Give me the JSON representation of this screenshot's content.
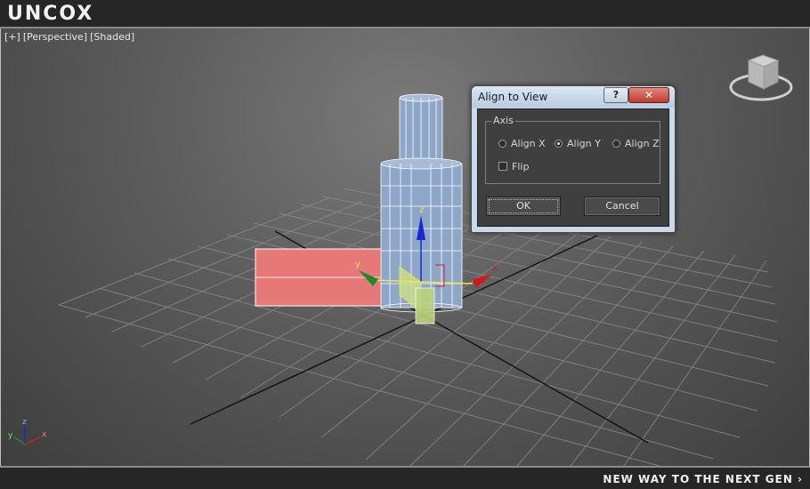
{
  "brand": {
    "logo": "UNCOX",
    "tagline": "NEW WAY TO THE NEXT GEN ›"
  },
  "viewport": {
    "labels": [
      "[+]",
      "[Perspective]",
      "[Shaded]"
    ]
  },
  "gizmo": {
    "x": "x",
    "y": "y",
    "z": "z"
  },
  "axis_tripod": {
    "x": "x",
    "y": "y",
    "z": "z"
  },
  "dialog": {
    "title": "Align to View",
    "help_label": "?",
    "close_label": "✕",
    "group_label": "Axis",
    "options": [
      {
        "label": "Align X",
        "selected": false
      },
      {
        "label": "Align Y",
        "selected": true
      },
      {
        "label": "Align Z",
        "selected": false
      }
    ],
    "flip_label": "Flip",
    "flip_checked": false,
    "ok_label": "OK",
    "cancel_label": "Cancel"
  },
  "colors": {
    "box_fill": "#e67878",
    "cylinder_fill": "#8ea6c8",
    "plane_fill": "#b9d47a",
    "axis_x": "#d01a1a",
    "axis_y": "#1e8a2a",
    "axis_z": "#1a2ad0"
  }
}
